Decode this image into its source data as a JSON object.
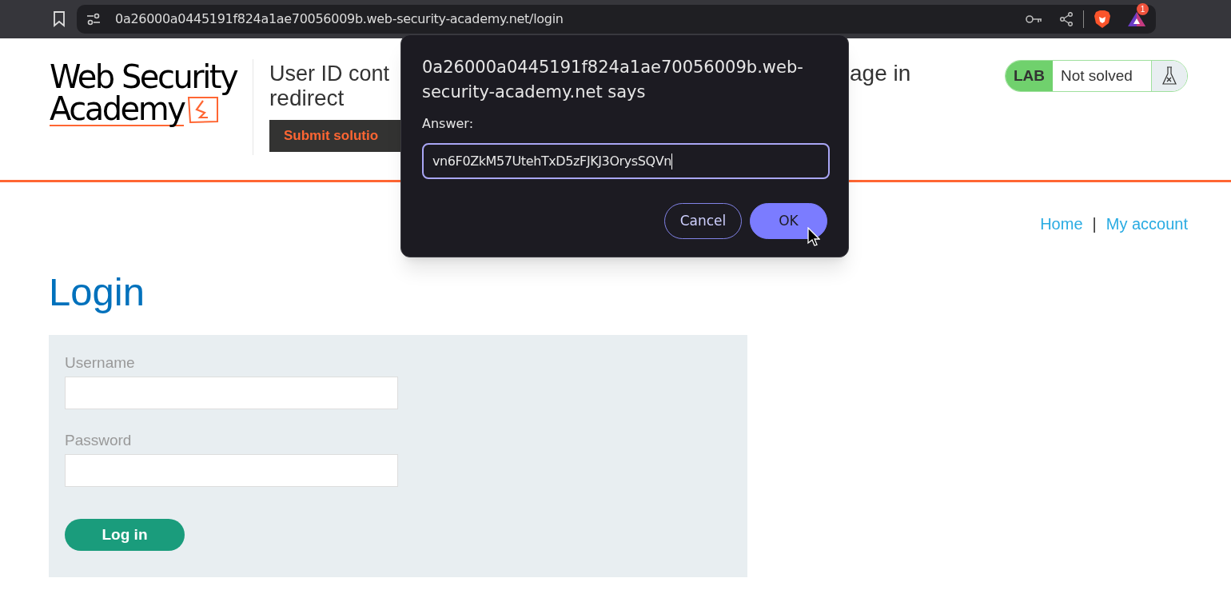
{
  "browser": {
    "url": "0a26000a0445191f824a1ae70056009b.web-security-academy.net/login",
    "rewards_badge": "1"
  },
  "header": {
    "logo_line1": "Web Security",
    "logo_line2": "Academy",
    "title_line1_start": "User ID cont",
    "title_line1_end": "age in",
    "title_line2": "redirect",
    "submit_button": "Submit solutio",
    "lab_badge": {
      "label": "LAB",
      "status": "Not solved",
      "solved": false
    }
  },
  "nav": [
    {
      "label": "Home"
    },
    {
      "label": "My account"
    }
  ],
  "nav_separator": "|",
  "login": {
    "heading": "Login",
    "fields": [
      {
        "label": "Username"
      },
      {
        "label": "Password"
      }
    ],
    "button": "Log in"
  },
  "dialog": {
    "title": "0a26000a0445191f824a1ae70056009b.web-security-academy.net says",
    "prompt": "Answer:",
    "value": "vn6F0ZkM57UtehTxD5zFJKJ3OrysSQVn",
    "buttons": [
      {
        "label": "Cancel",
        "kind": "secondary"
      },
      {
        "label": "OK",
        "kind": "primary"
      }
    ]
  }
}
